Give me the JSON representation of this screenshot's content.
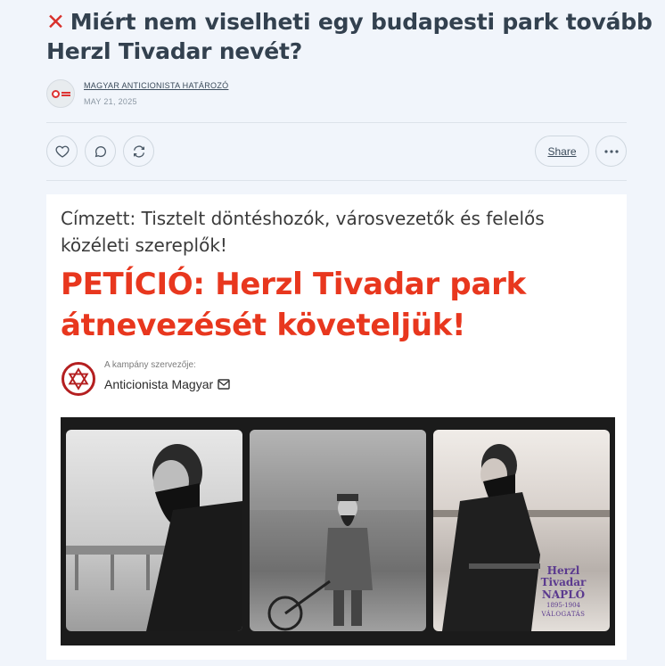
{
  "post": {
    "title": "Miért nem viselheti egy budapesti park tovább Herzl Tivadar nevét?",
    "author": "MAGYAR ANTICIONISTA HATÁROZÓ",
    "date": "MAY 21, 2025"
  },
  "actions": {
    "share_label": "Share"
  },
  "petition": {
    "addressee": "Címzett: Tisztelt döntéshozók, városvezetők és felelős közéleti szereplők!",
    "headline": "PETÍCIÓ: Herzl Tivadar park átnevezését követeljük!",
    "organizer_label": "A kampány szervezője:",
    "organizer_name": "Anticionista Magyar"
  },
  "images": {
    "book_line1": "Herzl",
    "book_line2": "Tivadar",
    "book_line3": "NAPLÓ",
    "book_years": "1895-1904",
    "book_sub": "VÁLOGATÁS"
  },
  "colors": {
    "accent_red": "#e8371e",
    "background": "#f1f5fb",
    "title_text": "#33414f"
  }
}
